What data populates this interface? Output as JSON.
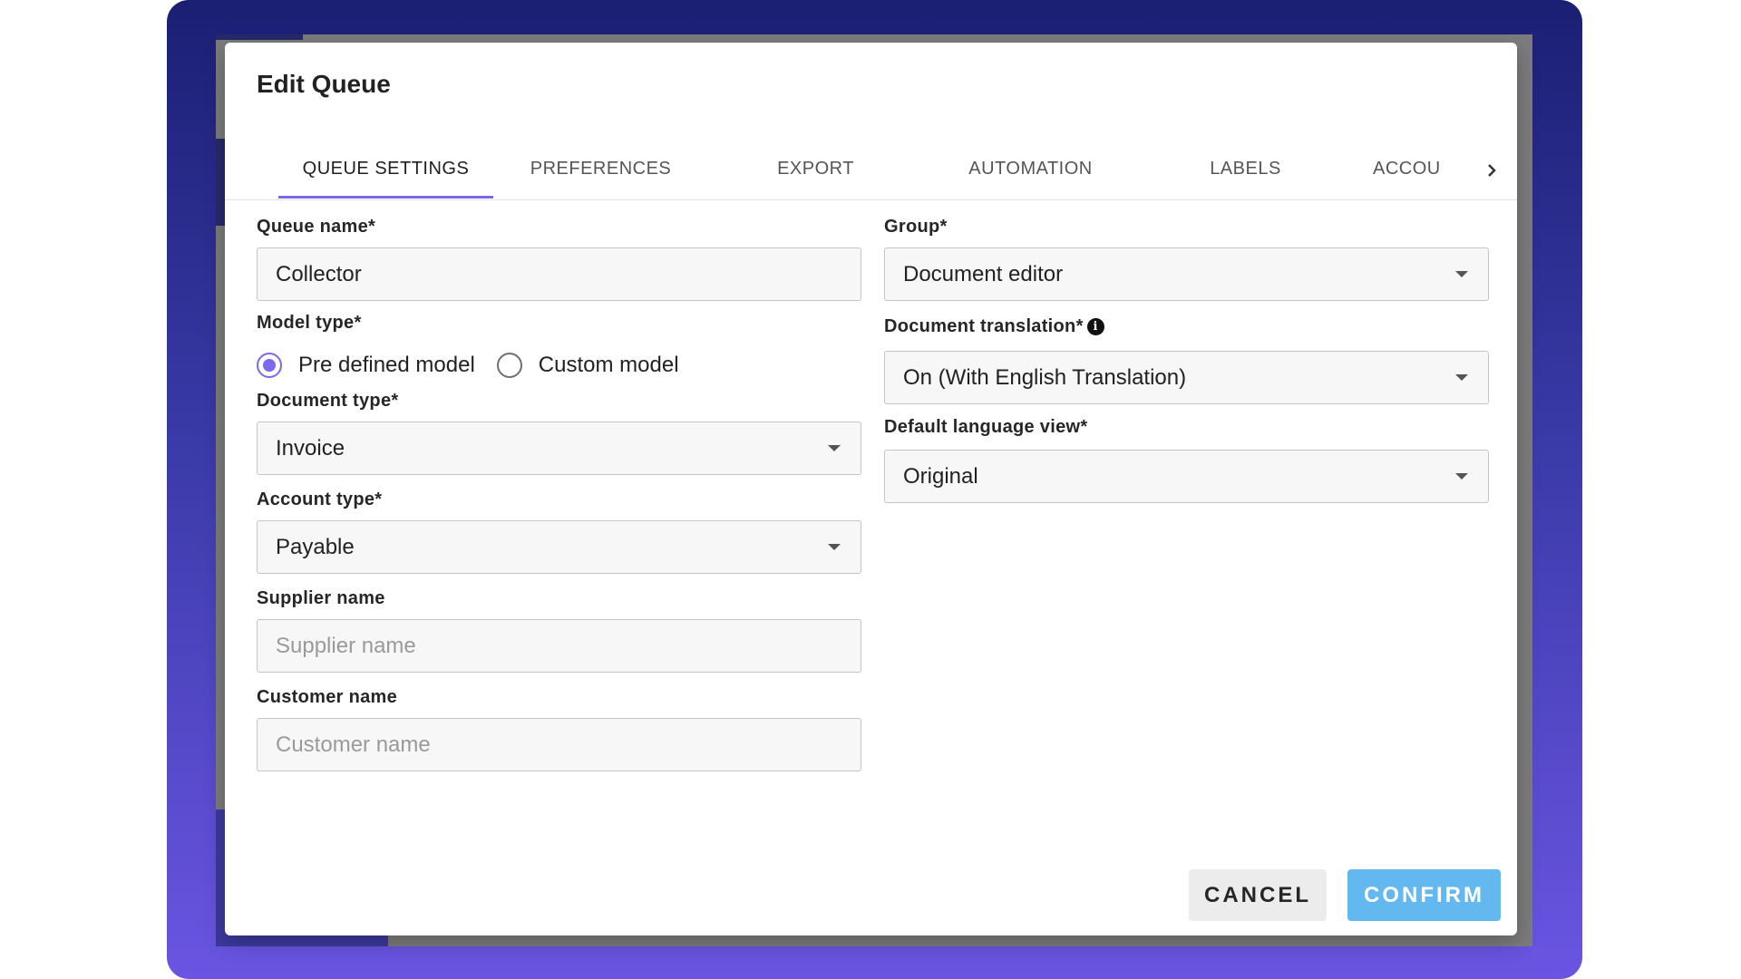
{
  "dialog": {
    "title": "Edit Queue"
  },
  "tabs": [
    {
      "label": "QUEUE SETTINGS",
      "active": true
    },
    {
      "label": "PREFERENCES",
      "active": false
    },
    {
      "label": "EXPORT",
      "active": false
    },
    {
      "label": "AUTOMATION",
      "active": false
    },
    {
      "label": "LABELS",
      "active": false
    },
    {
      "label": "ACCOU",
      "active": false
    }
  ],
  "form": {
    "queue_name": {
      "label": "Queue name*",
      "value": "Collector"
    },
    "model_type": {
      "label": "Model type*",
      "options": [
        {
          "label": "Pre defined model",
          "selected": true
        },
        {
          "label": "Custom model",
          "selected": false
        }
      ]
    },
    "document_type": {
      "label": "Document type*",
      "value": "Invoice"
    },
    "account_type": {
      "label": "Account type*",
      "value": "Payable"
    },
    "supplier_name": {
      "label": "Supplier name",
      "placeholder": "Supplier name",
      "value": ""
    },
    "customer_name": {
      "label": "Customer name",
      "placeholder": "Customer name",
      "value": ""
    },
    "group": {
      "label": "Group*",
      "value": "Document editor"
    },
    "document_translation": {
      "label": "Document translation*",
      "value": "On (With English Translation)"
    },
    "default_language_view": {
      "label": "Default language view*",
      "value": "Original"
    }
  },
  "actions": {
    "cancel_label": "CANCEL",
    "confirm_label": "CONFIRM"
  },
  "colors": {
    "accent": "#7a68ef",
    "confirm": "#63b9ef",
    "frame_top": "#1b1f73",
    "frame_bottom": "#6a55e2"
  }
}
